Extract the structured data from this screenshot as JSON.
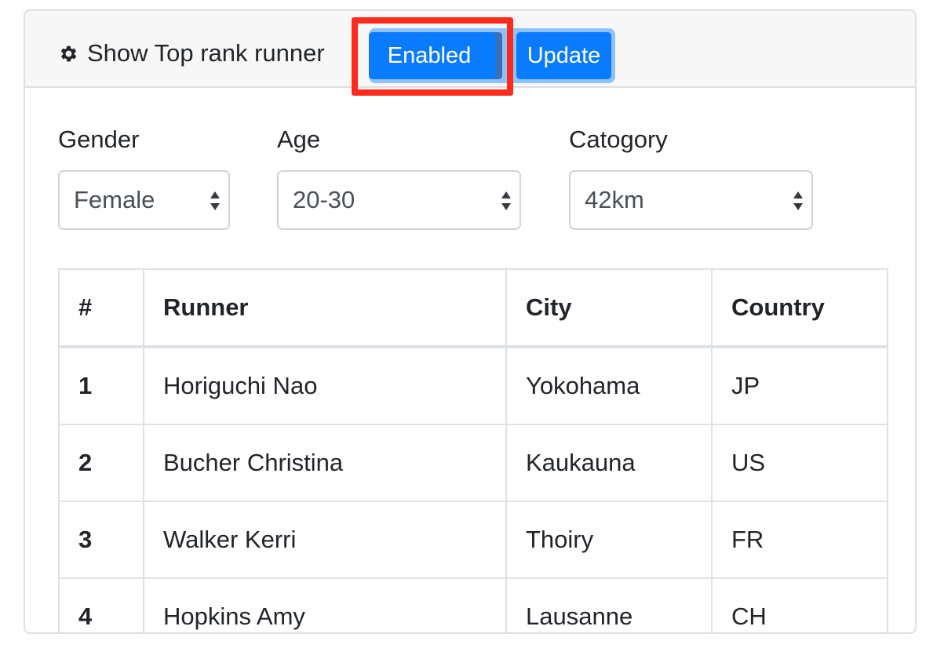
{
  "header": {
    "title": "Show Top rank runner",
    "icon": "gear-icon",
    "toggle_label": "Enabled",
    "update_label": "Update",
    "accent_color": "#0b7bfd",
    "highlight_color": "#fe2a1c"
  },
  "filters": {
    "gender": {
      "label": "Gender",
      "value": "Female"
    },
    "age": {
      "label": "Age",
      "value": "20-30"
    },
    "category": {
      "label": "Catogory",
      "value": "42km"
    }
  },
  "table": {
    "columns": [
      "#",
      "Runner",
      "City",
      "Country"
    ],
    "rows": [
      {
        "rank": "1",
        "runner": "Horiguchi Nao",
        "city": "Yokohama",
        "country": "JP"
      },
      {
        "rank": "2",
        "runner": "Bucher Christina",
        "city": "Kaukauna",
        "country": "US"
      },
      {
        "rank": "3",
        "runner": "Walker Kerri",
        "city": "Thoiry",
        "country": "FR"
      },
      {
        "rank": "4",
        "runner": "Hopkins Amy",
        "city": "Lausanne",
        "country": "CH"
      }
    ]
  }
}
